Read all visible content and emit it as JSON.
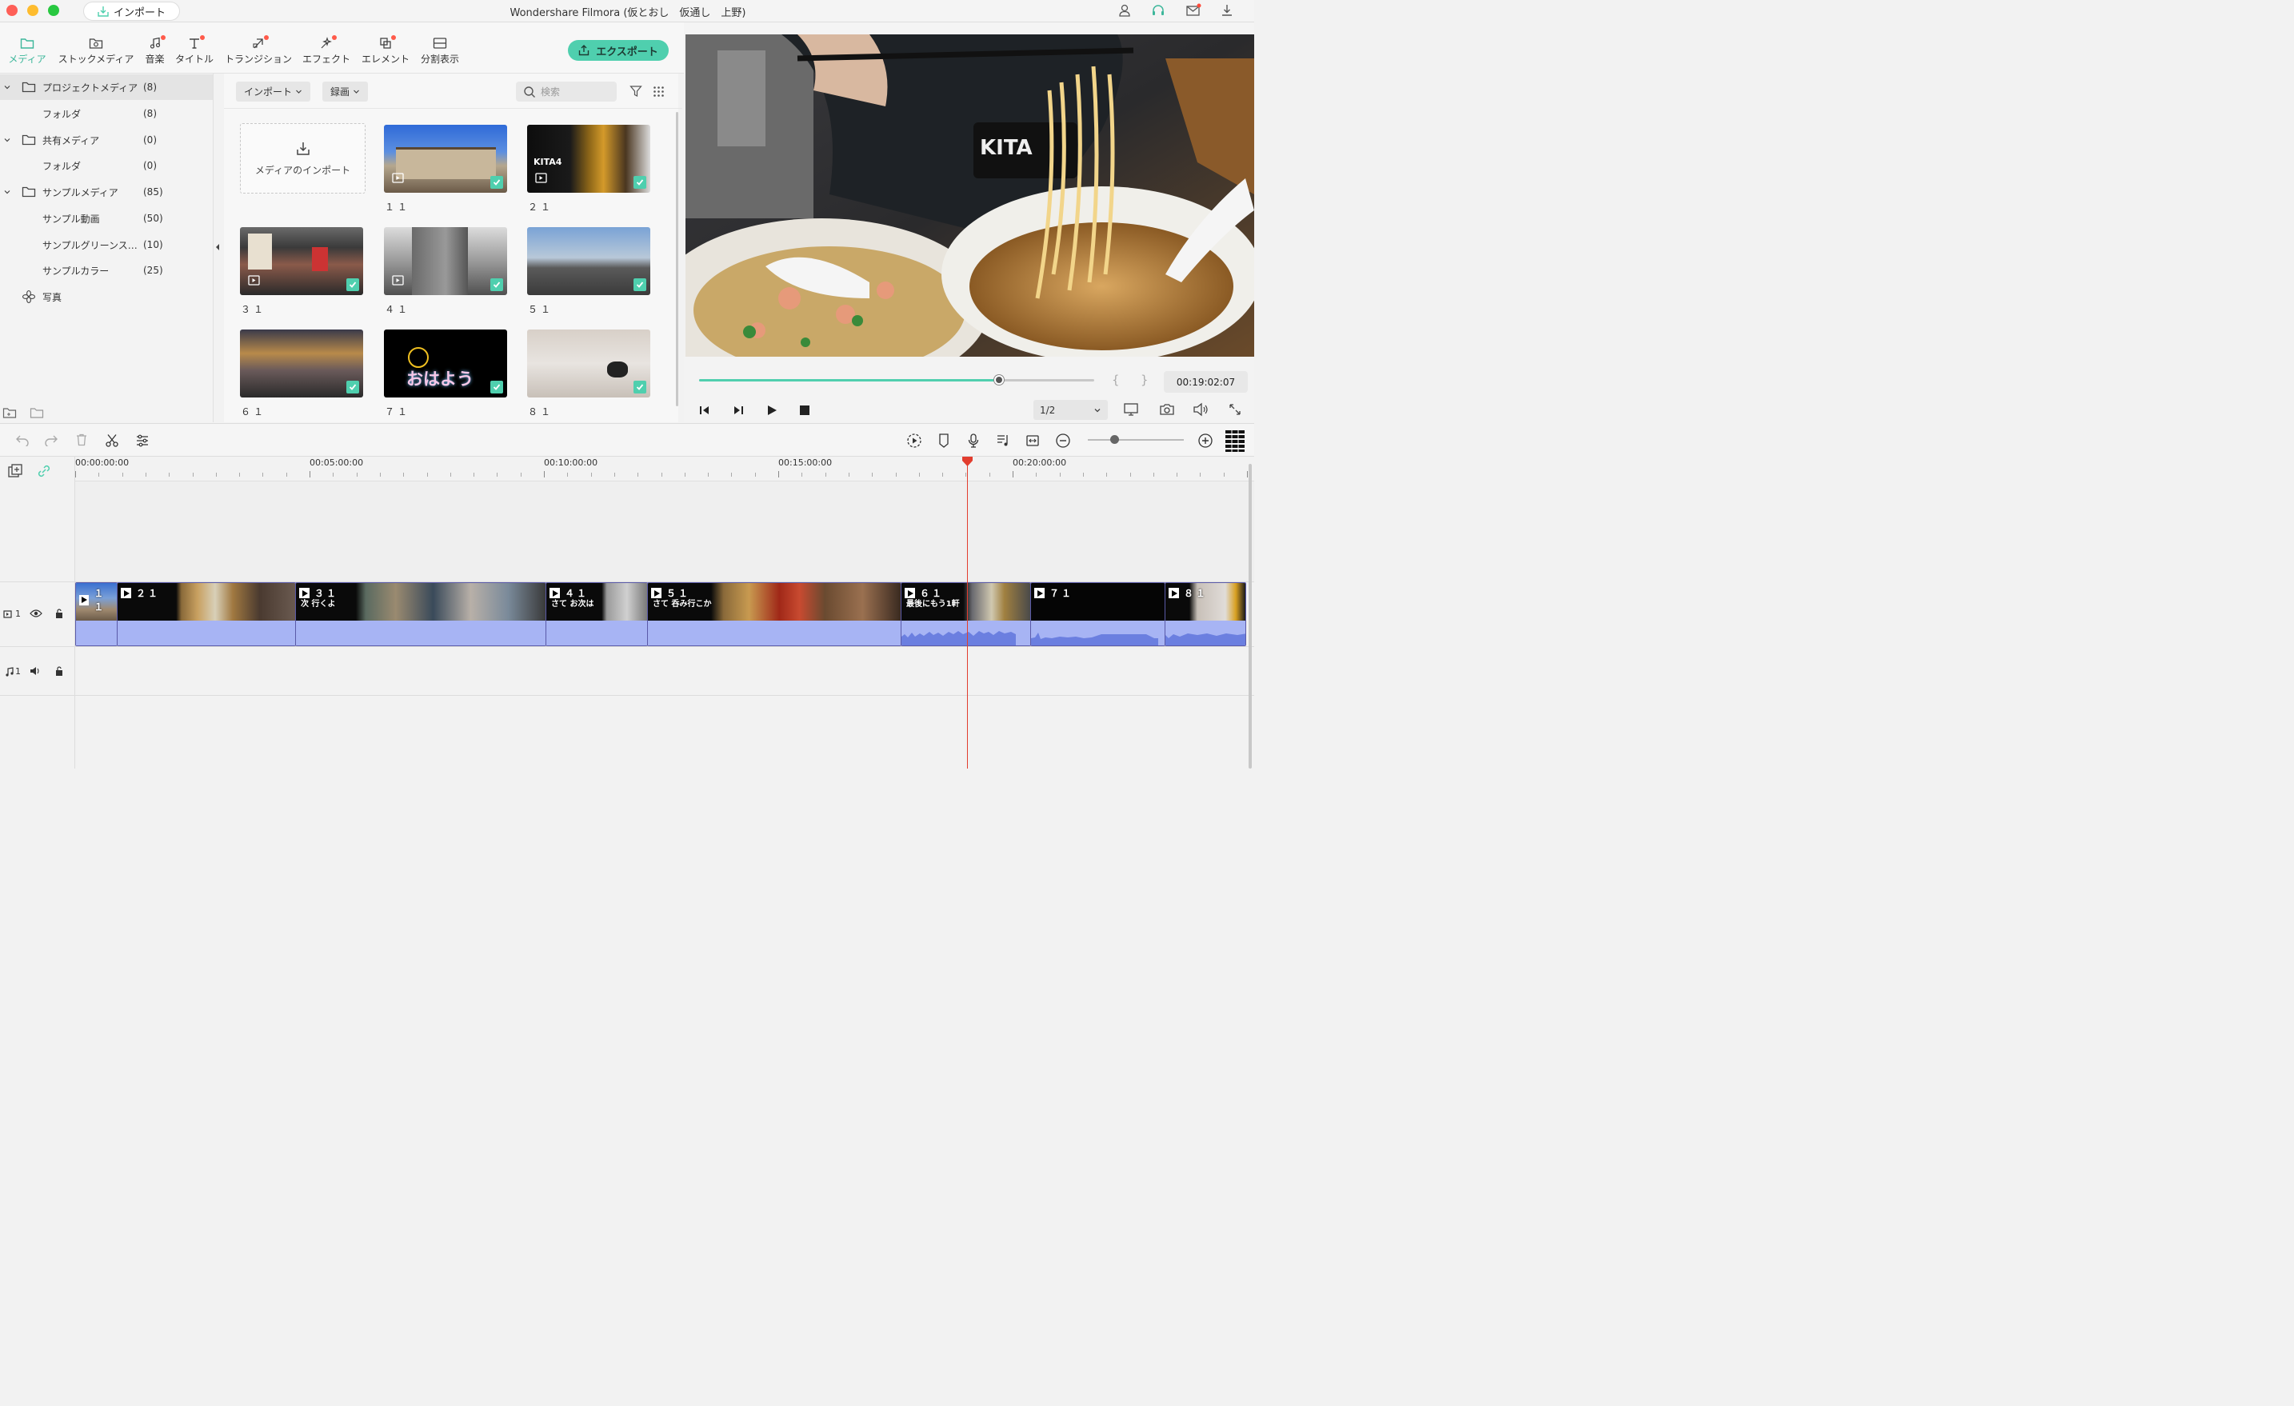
{
  "titlebar": {
    "import_label": "インポート",
    "window_title": "Wondershare Filmora (仮とおし　仮通し　上野)"
  },
  "tabs": [
    {
      "label": "メディア",
      "icon": "folder-icon"
    },
    {
      "label": "ストックメディア",
      "icon": "stock-media-icon"
    },
    {
      "label": "音楽",
      "icon": "music-icon"
    },
    {
      "label": "タイトル",
      "icon": "title-icon"
    },
    {
      "label": "トランジション",
      "icon": "transition-icon"
    },
    {
      "label": "エフェクト",
      "icon": "effect-icon"
    },
    {
      "label": "エレメント",
      "icon": "element-icon"
    },
    {
      "label": "分割表示",
      "icon": "split-screen-icon"
    }
  ],
  "export_label": "エクスポート",
  "sidebar": {
    "items": [
      {
        "label": "プロジェクトメディア",
        "count": "(8)"
      },
      {
        "label": "フォルダ",
        "count": "(8)"
      },
      {
        "label": "共有メディア",
        "count": "(0)"
      },
      {
        "label": "フォルダ",
        "count": "(0)"
      },
      {
        "label": "サンプルメディア",
        "count": "(85)"
      },
      {
        "label": "サンプル動画",
        "count": "(50)"
      },
      {
        "label": "サンプルグリーンス…",
        "count": "(10)"
      },
      {
        "label": "サンプルカラー",
        "count": "(25)"
      },
      {
        "label": "写真",
        "count": ""
      }
    ]
  },
  "media_toolbar": {
    "import_dropdown": "インポート",
    "record_dropdown": "録画",
    "search_placeholder": "検索"
  },
  "import_box_label": "メディアのインポート",
  "media_items": [
    "１１",
    "２１",
    "３１",
    "４１",
    "５１",
    "６１",
    "７１",
    "８１"
  ],
  "thumb_text": {
    "kita": "KITA4",
    "ohayou": "おはよう"
  },
  "player": {
    "timecode": "00:19:02:07",
    "quality": "1/2",
    "progress": 0.76,
    "brace_open": "{",
    "brace_close": "}"
  },
  "timeline": {
    "ruler_labels": [
      "00:00:00:00",
      "00:05:00:00",
      "00:10:00:00",
      "00:15:00:00",
      "00:20:00:00"
    ],
    "video_track_label": "1",
    "audio_track_label": "1",
    "clips": [
      {
        "label": "１１",
        "sub": ""
      },
      {
        "label": "２１",
        "sub": ""
      },
      {
        "label": "３１",
        "sub": "次 行くよ"
      },
      {
        "label": "４１",
        "sub": "さて お次は"
      },
      {
        "label": "５１",
        "sub": "さて 呑み行こか"
      },
      {
        "label": "６１",
        "sub": "最後にもう1軒"
      },
      {
        "label": "７１",
        "sub": ""
      },
      {
        "label": "８１",
        "sub": ""
      }
    ]
  },
  "colors": {
    "accent": "#4fcfae",
    "playhead": "#e23d2e",
    "clip_audio": "#a7b4f4",
    "clip_border": "#5a5aa8"
  }
}
